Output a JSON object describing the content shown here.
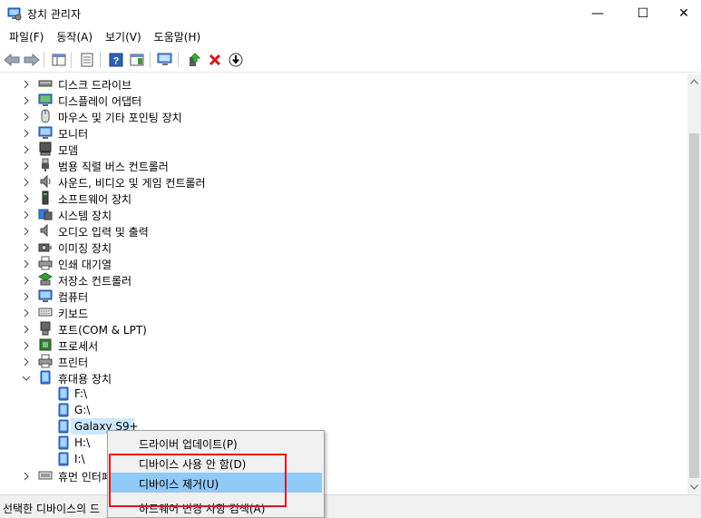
{
  "window": {
    "title": "장치 관리자",
    "min_glyph": "—",
    "max_glyph": "☐",
    "close_glyph": "✕"
  },
  "menu": {
    "items": [
      "파일(F)",
      "동작(A)",
      "보기(V)",
      "도움말(H)"
    ]
  },
  "tree": {
    "categories": [
      {
        "label": "디스크 드라이브",
        "icon": "disk-drive-icon"
      },
      {
        "label": "디스플레이 어댑터",
        "icon": "display-adapter-icon"
      },
      {
        "label": "마우스 및 기타 포인팅 장치",
        "icon": "mouse-icon"
      },
      {
        "label": "모니터",
        "icon": "monitor-icon"
      },
      {
        "label": "모뎀",
        "icon": "modem-icon"
      },
      {
        "label": "범용 직렬 버스 컨트롤러",
        "icon": "usb-icon"
      },
      {
        "label": "사운드, 비디오 및 게임 컨트롤러",
        "icon": "speaker-icon"
      },
      {
        "label": "소프트웨어 장치",
        "icon": "software-device-icon"
      },
      {
        "label": "시스템 장치",
        "icon": "system-device-icon"
      },
      {
        "label": "오디오 입력 및 출력",
        "icon": "audio-icon"
      },
      {
        "label": "이미징 장치",
        "icon": "camera-icon"
      },
      {
        "label": "인쇄 대기열",
        "icon": "printer-queue-icon"
      },
      {
        "label": "저장소 컨트롤러",
        "icon": "storage-controller-icon"
      },
      {
        "label": "컴퓨터",
        "icon": "computer-icon"
      },
      {
        "label": "키보드",
        "icon": "keyboard-icon"
      },
      {
        "label": "포트(COM & LPT)",
        "icon": "port-icon"
      },
      {
        "label": "프로세서",
        "icon": "processor-icon"
      },
      {
        "label": "프린터",
        "icon": "printer-icon"
      },
      {
        "label": "휴대용 장치",
        "icon": "portable-device-icon",
        "expanded": true
      }
    ],
    "portable_children": [
      {
        "label": "F:\\"
      },
      {
        "label": "G:\\"
      },
      {
        "label": "Galaxy S9+",
        "selected": true
      },
      {
        "label": "H:\\"
      },
      {
        "label": "I:\\"
      }
    ],
    "last_category": {
      "label": "휴먼 인터페이스 장치",
      "icon": "hid-icon"
    }
  },
  "context_menu": {
    "items": [
      {
        "label": "드라이버 업데이트(P)"
      },
      {
        "label": "디바이스 사용 안 함(D)"
      },
      {
        "label": "디바이스 제거(U)",
        "highlighted": true
      },
      {
        "label": "하드웨어 변경 사항 검색(A)"
      }
    ]
  },
  "status": {
    "text": "선택한 디바이스의 드"
  },
  "colors": {
    "selection": "#cce8ff",
    "menu_highlight": "#91c9f7",
    "annotation_red": "#e8121c"
  }
}
